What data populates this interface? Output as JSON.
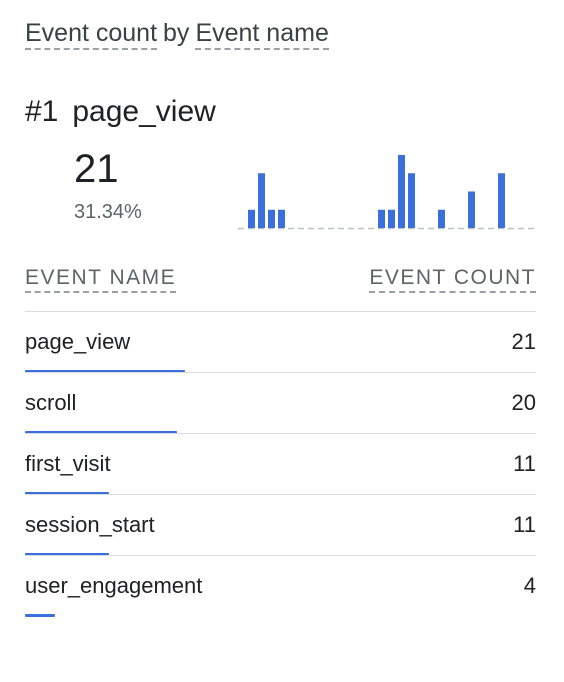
{
  "card": {
    "title_metric": "Event count",
    "title_by": "by",
    "title_dimension": "Event name"
  },
  "top_item": {
    "rank": "#1",
    "name": "page_view",
    "value": "21",
    "percent": "31.34%"
  },
  "chart_data": {
    "type": "bar",
    "values": [
      1,
      3,
      1,
      1,
      0,
      0,
      0,
      0,
      0,
      0,
      0,
      0,
      0,
      1,
      1,
      4,
      3,
      0,
      0,
      1,
      0,
      0,
      2,
      0,
      0,
      3,
      0
    ],
    "ylim": [
      0,
      4
    ],
    "color": "#3b6fdb",
    "baseline_style": "dashed"
  },
  "table": {
    "col_name": "EVENT NAME",
    "col_count": "EVENT COUNT",
    "rows": [
      {
        "name": "page_view",
        "count": "21",
        "value": 21
      },
      {
        "name": "scroll",
        "count": "20",
        "value": 20
      },
      {
        "name": "first_visit",
        "count": "11",
        "value": 11
      },
      {
        "name": "session_start",
        "count": "11",
        "value": 11
      },
      {
        "name": "user_engagement",
        "count": "4",
        "value": 4
      }
    ],
    "max_value": 21,
    "bar_color": "#3b6fdb"
  }
}
